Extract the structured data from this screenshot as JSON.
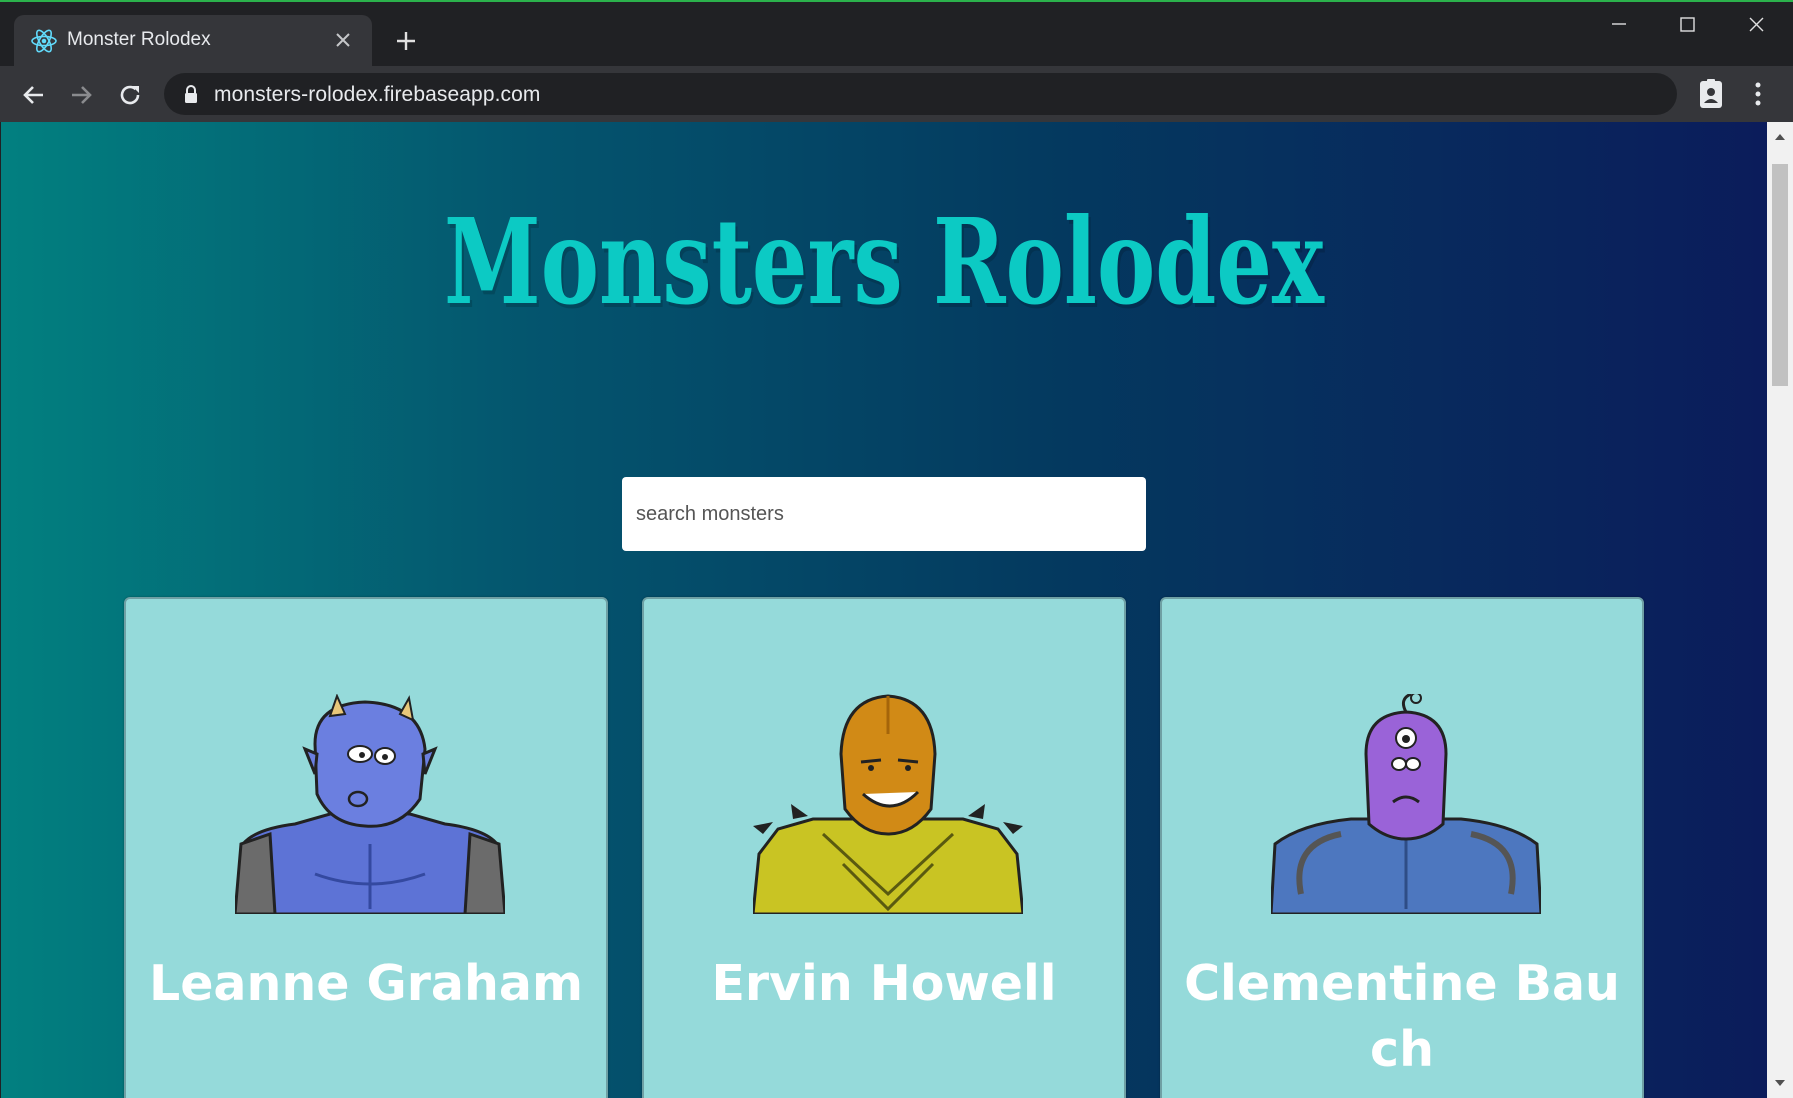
{
  "browser": {
    "tab_title": "Monster Rolodex",
    "url": "monsters-rolodex.firebaseapp.com"
  },
  "page": {
    "title": "Monsters Rolodex",
    "search_placeholder": "search monsters"
  },
  "monsters": [
    {
      "name": "Leanne Graham",
      "avatar": "blue-horned-monster"
    },
    {
      "name": "Ervin Howell",
      "avatar": "orange-hooded-monster"
    },
    {
      "name": "Clementine Bauch",
      "avatar": "purple-cyclops-monster"
    }
  ]
}
